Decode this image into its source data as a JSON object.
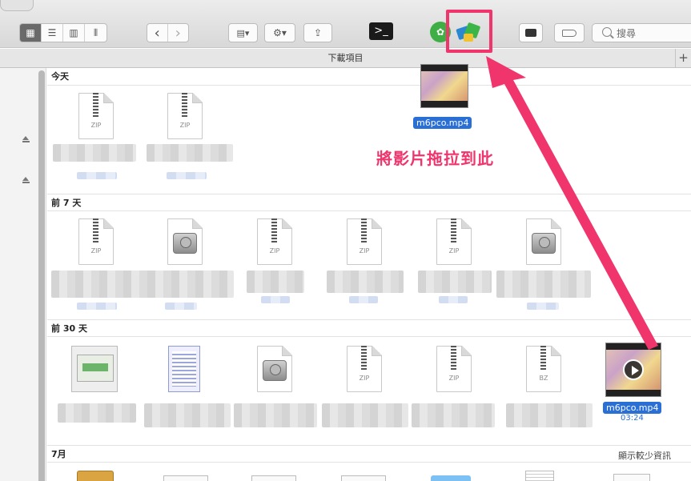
{
  "colors": {
    "accent": "#f0346c",
    "selection": "#2a6fd6"
  },
  "toolbar": {
    "view_icons": [
      "icon-view-icon",
      "list-view-icon",
      "column-view-icon",
      "cover-flow-icon"
    ],
    "back": "‹",
    "forward": "›",
    "arrange_icon": "arrange-icon",
    "action_icon": "gear-icon",
    "share_icon": "share-icon",
    "tags_icon": "tag-icon",
    "search_placeholder": "搜尋"
  },
  "path_title": "下載項目",
  "plus": "+",
  "sections": [
    {
      "title": "今天"
    },
    {
      "title": "前 7 天"
    },
    {
      "title": "前 30 天"
    },
    {
      "title": "7月"
    }
  ],
  "show_less": "顯示較少資訊",
  "drag": {
    "name": "m6pco.mp4"
  },
  "video": {
    "name": "m6pco.mp4",
    "duration": "03:24"
  },
  "zip_label": "ZIP",
  "bz_label": "BZ",
  "annotation": "將影片拖拉到此"
}
